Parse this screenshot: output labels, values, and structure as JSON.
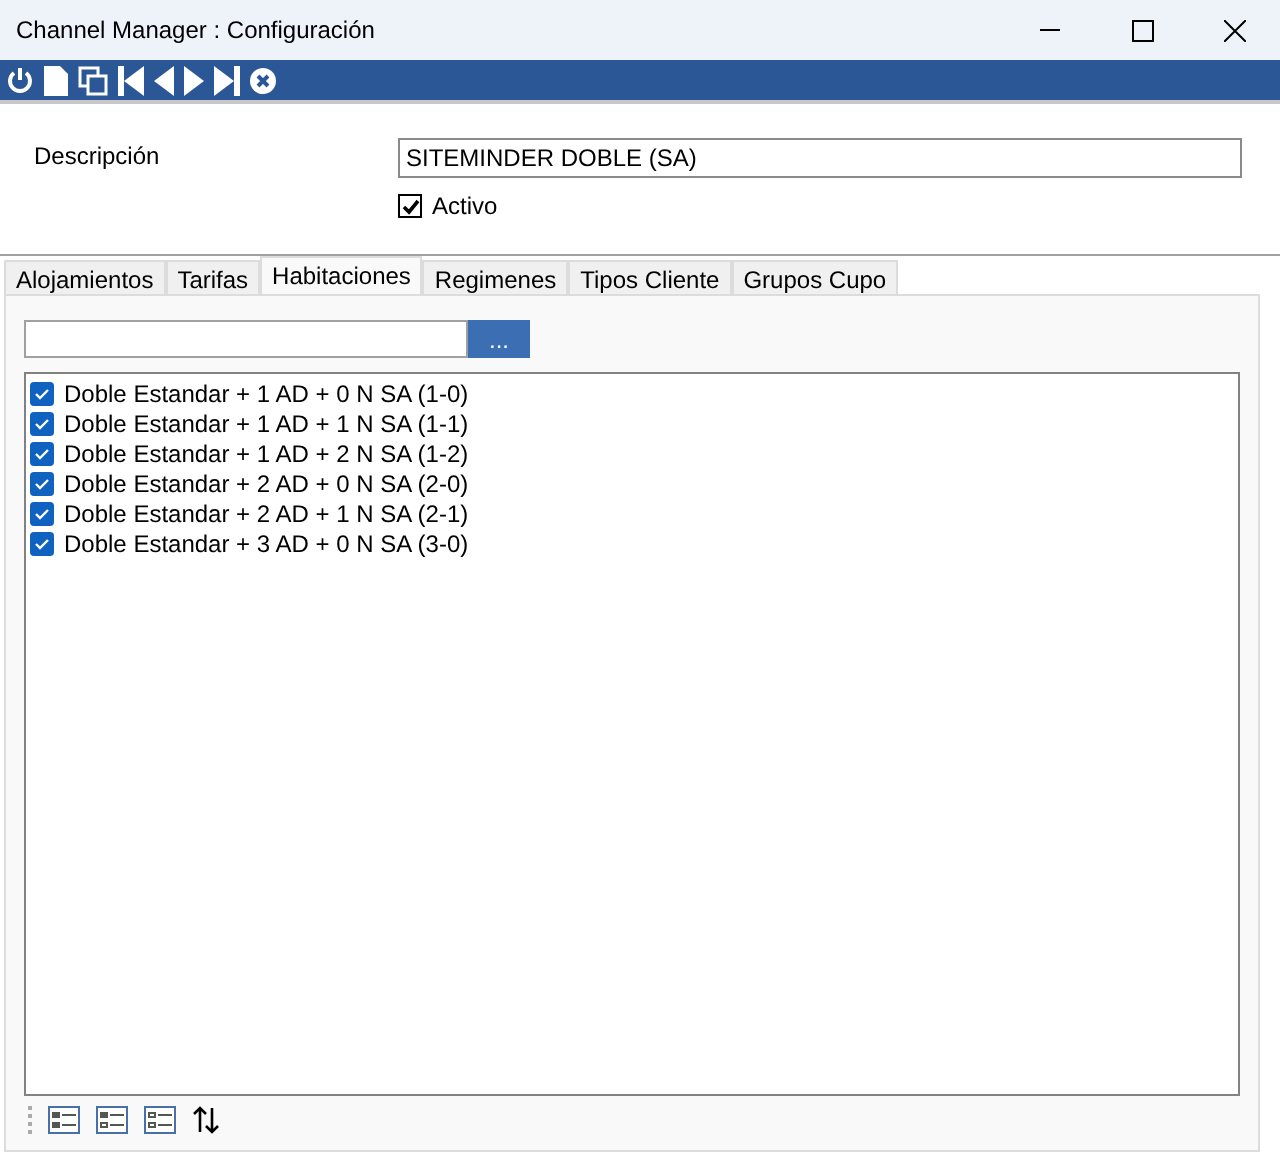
{
  "window": {
    "title": "Channel Manager : Configuración"
  },
  "form": {
    "description_label": "Descripción",
    "description_value": "SITEMINDER DOBLE (SA)",
    "active": {
      "label": "Activo",
      "checked": true
    }
  },
  "tabs": [
    {
      "label": "Alojamientos",
      "selected": false
    },
    {
      "label": "Tarifas",
      "selected": false
    },
    {
      "label": "Habitaciones",
      "selected": true
    },
    {
      "label": "Regimenes",
      "selected": false
    },
    {
      "label": "Tipos Cliente",
      "selected": false
    },
    {
      "label": "Grupos Cupo",
      "selected": false
    }
  ],
  "search": {
    "button": "..."
  },
  "rooms": [
    {
      "label": "Doble Estandar + 1 AD + 0 N SA (1-0)",
      "checked": true
    },
    {
      "label": "Doble Estandar + 1 AD + 1 N SA (1-1)",
      "checked": true
    },
    {
      "label": "Doble Estandar + 1 AD + 2 N SA (1-2)",
      "checked": true
    },
    {
      "label": "Doble Estandar + 2 AD + 0 N SA (2-0)",
      "checked": true
    },
    {
      "label": "Doble Estandar + 2 AD + 1 N SA (2-1)",
      "checked": true
    },
    {
      "label": "Doble Estandar + 3 AD + 0 N SA (3-0)",
      "checked": true
    }
  ]
}
